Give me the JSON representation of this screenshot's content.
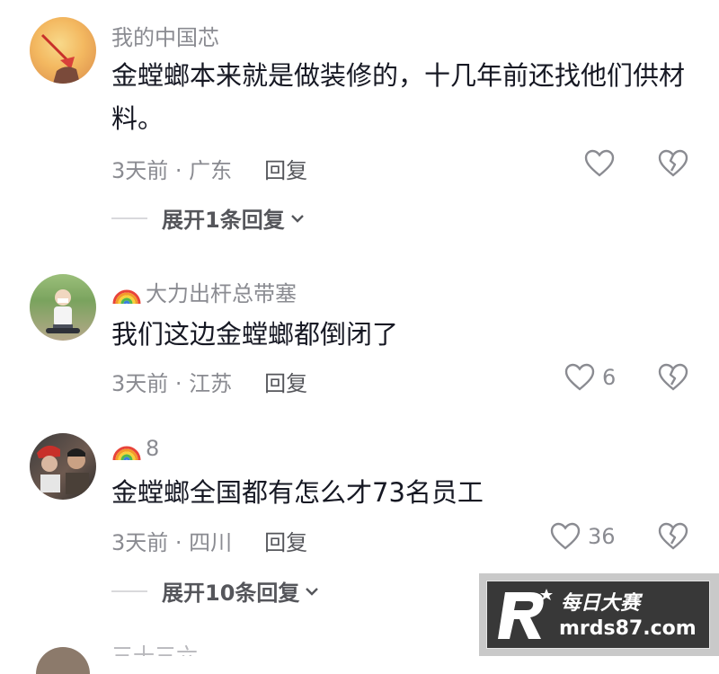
{
  "comments": [
    {
      "username": "我的中国芯",
      "text": "金螳螂本来就是做装修的，十几年前还找他们供材料。",
      "time": "3天前",
      "location": "广东",
      "meta": "3天前 · 广东",
      "reply_label": "回复",
      "likes": "",
      "expand": "展开1条回复",
      "avatar_icon": "sunset-avatar"
    },
    {
      "username": "大力出杆总带塞",
      "text": "我们这边金螳螂都倒闭了",
      "time": "3天前",
      "location": "江苏",
      "meta": "3天前 · 江苏",
      "reply_label": "回复",
      "likes": "6",
      "avatar_icon": "child-photo-avatar"
    },
    {
      "username": "8",
      "text": "金螳螂全国都有怎么才73名员工",
      "time": "3天前",
      "location": "四川",
      "meta": "3天前 · 四川",
      "reply_label": "回复",
      "likes": "36",
      "expand": "展开10条回复",
      "avatar_icon": "group-photo-avatar"
    }
  ],
  "partial_next_username": "三十三六",
  "watermark": {
    "brand_cn": "每日大赛",
    "url": "mrds87.com"
  },
  "colors": {
    "text": "#161823",
    "secondary": "#8a8b91",
    "reply": "#55565b"
  }
}
